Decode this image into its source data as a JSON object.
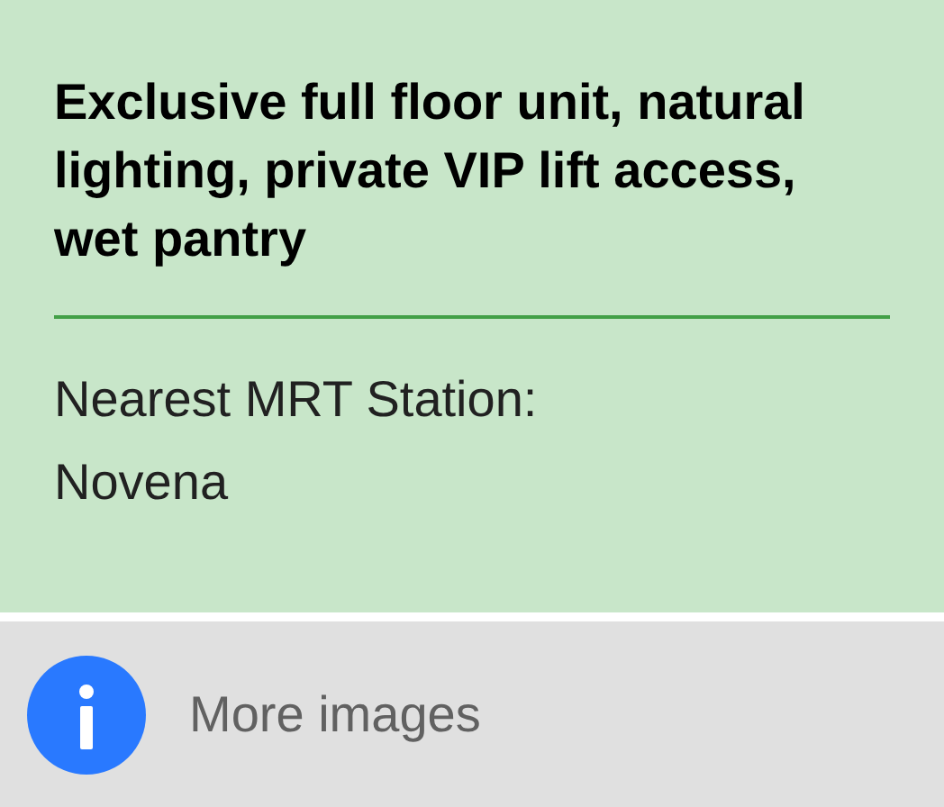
{
  "card": {
    "description": "Exclusive full floor unit, natural lighting, private VIP lift access, wet pantry",
    "mrt_label": "Nearest MRT Station:",
    "mrt_station": "Novena"
  },
  "footer": {
    "link": "More images"
  }
}
